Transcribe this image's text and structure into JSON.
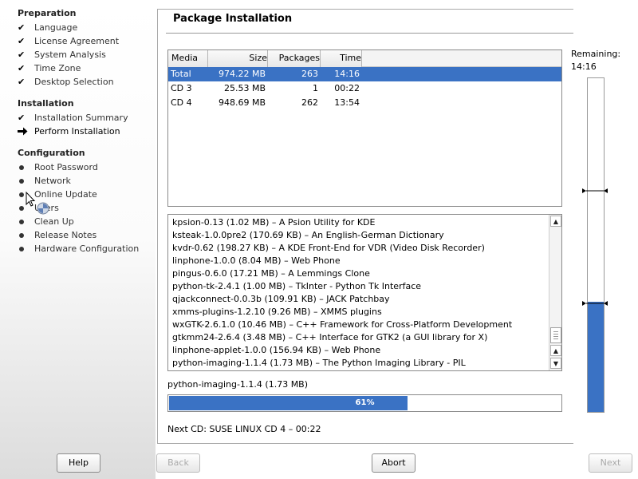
{
  "sidebar": {
    "sections": [
      {
        "title": "Preparation"
      },
      {
        "title": "Installation"
      },
      {
        "title": "Configuration"
      }
    ],
    "preparation": [
      "Language",
      "License Agreement",
      "System Analysis",
      "Time Zone",
      "Desktop Selection"
    ],
    "installation": [
      "Installation Summary",
      "Perform Installation"
    ],
    "configuration": [
      "Root Password",
      "Network",
      "Online Update",
      "Users",
      "Clean Up",
      "Release Notes",
      "Hardware Configuration"
    ]
  },
  "page": {
    "title": "Package Installation"
  },
  "media_table": {
    "headers": [
      "Media",
      "Size",
      "Packages",
      "Time"
    ],
    "rows": [
      {
        "media": "Total",
        "size": "974.22 MB",
        "packages": "263",
        "time": "14:16",
        "selected": true
      },
      {
        "media": "CD 3",
        "size": "25.53 MB",
        "packages": "1",
        "time": "00:22",
        "selected": false
      },
      {
        "media": "CD 4",
        "size": "948.69 MB",
        "packages": "262",
        "time": "13:54",
        "selected": false
      }
    ]
  },
  "log_lines": [
    "kpsion-0.13 (1.02 MB) – A Psion Utility for KDE",
    "ksteak-1.0.0pre2 (170.69 KB) – An English-German Dictionary",
    "kvdr-0.62 (198.27 KB) – A KDE Front-End for VDR (Video Disk Recorder)",
    "linphone-1.0.0 (8.04 MB) – Web Phone",
    "pingus-0.6.0 (17.21 MB) – A Lemmings Clone",
    "python-tk-2.4.1 (1.00 MB) – TkInter - Python Tk Interface",
    "qjackconnect-0.0.3b (109.91 KB) – JACK Patchbay",
    "xmms-plugins-1.2.10 (9.26 MB) – XMMS plugins",
    "wxGTK-2.6.1.0 (10.46 MB) – C++ Framework for Cross-Platform Development",
    "gtkmm24-2.6.4 (3.48 MB) – C++ Interface for GTK2 (a GUI library for X)",
    "linphone-applet-1.0.0 (156.94 KB) – Web Phone",
    "python-imaging-1.1.4 (1.73 MB) – The Python Imaging Library - PIL"
  ],
  "current_package": "python-imaging-1.1.4 (1.73 MB)",
  "progress": {
    "percent": 61,
    "label": "61%"
  },
  "next_cd": "Next CD: SUSE LINUX CD 4 – 00:22",
  "remaining": {
    "label": "Remaining:",
    "time": "14:16",
    "fill_fraction": 0.33
  },
  "buttons": {
    "help": "Help",
    "back": "Back",
    "abort": "Abort",
    "next": "Next"
  },
  "colors": {
    "accent": "#3a72c4"
  }
}
